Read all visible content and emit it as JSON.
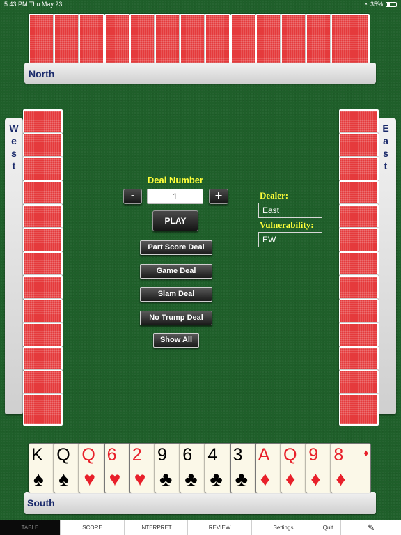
{
  "status_bar": {
    "time": "5:43 PM",
    "date": "Thu May 23",
    "battery": "35%",
    "wifi_icon": "wifi-icon"
  },
  "players": {
    "north": "North",
    "south": "South",
    "west": "West",
    "east": "East"
  },
  "deal": {
    "title": "Deal Number",
    "number": "1",
    "minus_label": "-",
    "plus_label": "+",
    "play_label": "PLAY"
  },
  "deal_options": [
    "Part Score Deal",
    "Game Deal",
    "Slam Deal",
    "No Trump Deal",
    "Show All"
  ],
  "dealer": {
    "label": "Dealer:",
    "value": "East"
  },
  "vulnerability": {
    "label": "Vulnerability:",
    "value": "EW"
  },
  "south_hand": [
    {
      "rank": "K",
      "suit": "♠",
      "color": "#000000"
    },
    {
      "rank": "Q",
      "suit": "♠",
      "color": "#000000"
    },
    {
      "rank": "Q",
      "suit": "♥",
      "color": "#e8202a"
    },
    {
      "rank": "6",
      "suit": "♥",
      "color": "#e8202a"
    },
    {
      "rank": "2",
      "suit": "♥",
      "color": "#e8202a"
    },
    {
      "rank": "9",
      "suit": "♣",
      "color": "#000000"
    },
    {
      "rank": "6",
      "suit": "♣",
      "color": "#000000"
    },
    {
      "rank": "4",
      "suit": "♣",
      "color": "#000000"
    },
    {
      "rank": "3",
      "suit": "♣",
      "color": "#000000"
    },
    {
      "rank": "A",
      "suit": "♦",
      "color": "#e8202a"
    },
    {
      "rank": "Q",
      "suit": "♦",
      "color": "#e8202a"
    },
    {
      "rank": "9",
      "suit": "♦",
      "color": "#e8202a"
    },
    {
      "rank": "8",
      "suit": "♦",
      "color": "#e8202a"
    }
  ],
  "tabs": [
    {
      "label": "TABLE",
      "active": true
    },
    {
      "label": "SCORE",
      "active": false
    },
    {
      "label": "INTERPRET",
      "active": false
    },
    {
      "label": "REVIEW",
      "active": false
    },
    {
      "label": "Settings",
      "active": false
    },
    {
      "label": "Quit",
      "active": false
    }
  ],
  "edit_icon": "edit-icon"
}
